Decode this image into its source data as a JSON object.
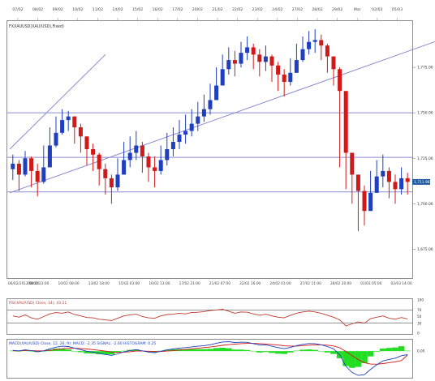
{
  "chart_data": [
    {
      "type": "candlestick",
      "title": "FXXAUUSD(XAU/USD),Fixed)",
      "top_dates": [
        "07/02",
        "08/02",
        "09/02",
        "10/02",
        "11/02",
        "14/02",
        "15/02",
        "16/02",
        "17/02",
        "20/02",
        "21/02",
        "22/02",
        "23/02",
        "24/02",
        "27/02",
        "28/02",
        "29/02",
        "Mar",
        "02/03",
        "05/03"
      ],
      "bottom_dates": [
        "06/02/2012 04:00",
        "08/02 23:00",
        "10/02 08:00",
        "13/02 18:00",
        "15/02 03:00",
        "16/02 13:00",
        "17/02 21:00",
        "21/02 07:00",
        "22/02 16:00",
        "24/02 01:00",
        "27/02 11:00",
        "28/02 20:00",
        "01/03 05:00",
        "02/03 14:00"
      ],
      "y_ticks": [
        "1,775.00",
        "1,750.00",
        "1,725.00",
        "1,700.00",
        "1,675.00"
      ],
      "ylim": [
        1660,
        1800
      ],
      "last_price": "1,711.98",
      "horizontal_lines": [
        1750.0,
        1725.5,
        1706.5
      ],
      "trend_lines": [
        {
          "from": [
            0,
            1730
          ],
          "to": [
            15,
            1782
          ]
        },
        {
          "from": [
            0,
            1706
          ],
          "to": [
            70,
            1791
          ]
        }
      ],
      "closes": [
        1722,
        1716,
        1725,
        1718,
        1712,
        1720,
        1732,
        1739,
        1746,
        1748,
        1742,
        1737,
        1730,
        1727,
        1719,
        1714,
        1709,
        1716,
        1724,
        1728,
        1732,
        1726,
        1720,
        1718,
        1724,
        1730,
        1734,
        1738,
        1740,
        1744,
        1748,
        1752,
        1757,
        1765,
        1774,
        1779,
        1777,
        1783,
        1786,
        1782,
        1778,
        1781,
        1776,
        1771,
        1767,
        1772,
        1779,
        1785,
        1789,
        1790,
        1787,
        1781,
        1774,
        1762,
        1728,
        1716,
        1707,
        1696,
        1706,
        1715,
        1718,
        1712,
        1708,
        1714,
        1712
      ],
      "highs": [
        1727,
        1724,
        1729,
        1726,
        1722,
        1732,
        1742,
        1748,
        1752,
        1751,
        1748,
        1744,
        1737,
        1733,
        1728,
        1722,
        1716,
        1725,
        1734,
        1737,
        1740,
        1734,
        1728,
        1726,
        1732,
        1739,
        1742,
        1746,
        1749,
        1752,
        1756,
        1760,
        1766,
        1775,
        1782,
        1786,
        1784,
        1789,
        1792,
        1788,
        1785,
        1787,
        1782,
        1778,
        1774,
        1780,
        1788,
        1792,
        1795,
        1796,
        1793,
        1788,
        1781,
        1775,
        1740,
        1728,
        1716,
        1710,
        1718,
        1724,
        1727,
        1720,
        1716,
        1720,
        1717
      ],
      "lows": [
        1713,
        1707,
        1715,
        1709,
        1704,
        1711,
        1724,
        1731,
        1738,
        1740,
        1733,
        1728,
        1721,
        1718,
        1710,
        1705,
        1700,
        1707,
        1716,
        1720,
        1724,
        1717,
        1712,
        1709,
        1716,
        1721,
        1726,
        1730,
        1733,
        1737,
        1740,
        1745,
        1749,
        1758,
        1767,
        1771,
        1770,
        1775,
        1779,
        1774,
        1770,
        1773,
        1767,
        1762,
        1759,
        1765,
        1772,
        1778,
        1782,
        1783,
        1779,
        1772,
        1765,
        1720,
        1708,
        1700,
        1685,
        1688,
        1698,
        1706,
        1709,
        1703,
        1700,
        1705,
        1705
      ],
      "rsi": {
        "label": "RSI(XAU/USD) Close, 14): 43.11",
        "ticks": [
          "100",
          "70",
          "50",
          "30",
          "0"
        ],
        "levels": [
          70,
          30
        ],
        "values": [
          52,
          48,
          55,
          46,
          42,
          50,
          58,
          62,
          60,
          64,
          56,
          52,
          47,
          46,
          42,
          40,
          38,
          45,
          52,
          55,
          57,
          50,
          46,
          45,
          52,
          56,
          57,
          60,
          58,
          62,
          63,
          65,
          68,
          70,
          72,
          66,
          60,
          64,
          63,
          58,
          54,
          57,
          52,
          48,
          46,
          54,
          60,
          64,
          66,
          64,
          60,
          54,
          48,
          40,
          22,
          28,
          34,
          30,
          44,
          48,
          52,
          45,
          42,
          47,
          43
        ]
      },
      "macd": {
        "label": "MACD(XAU/USD) Close, 12, 26, 9): MACD: -2.35 SIGNAL: -2.60 HISTOGRAM: 0.25",
        "zero_tick": "0.00",
        "macd_values": [
          0.5,
          0.2,
          0.8,
          0.3,
          -0.4,
          0.2,
          1.5,
          2.6,
          3.2,
          3.0,
          2.0,
          1.0,
          -0.1,
          -0.6,
          -1.5,
          -2.2,
          -2.8,
          -1.8,
          -0.5,
          0.4,
          1.0,
          0.2,
          -0.6,
          -1.0,
          -0.1,
          0.8,
          1.4,
          2.0,
          2.3,
          2.8,
          3.2,
          3.6,
          4.2,
          5.2,
          6.0,
          6.2,
          5.6,
          5.9,
          5.8,
          4.9,
          4.0,
          4.1,
          3.2,
          2.3,
          1.6,
          2.4,
          3.6,
          4.5,
          5.0,
          4.9,
          4.2,
          3.0,
          1.5,
          -2.5,
          -10.0,
          -14.0,
          -16.0,
          -15.5,
          -12.0,
          -9.0,
          -6.5,
          -5.5,
          -4.6,
          -3.0,
          -2.35
        ],
        "signal_values": [
          0.2,
          0.2,
          0.4,
          0.4,
          0.2,
          0.2,
          0.5,
          1.0,
          1.5,
          1.9,
          1.9,
          1.7,
          1.4,
          1.0,
          0.5,
          0.0,
          -0.6,
          -0.8,
          -0.7,
          -0.4,
          0.0,
          0.0,
          -0.1,
          -0.3,
          -0.3,
          0.0,
          0.3,
          0.7,
          1.1,
          1.5,
          1.9,
          2.3,
          2.7,
          3.2,
          3.8,
          4.3,
          4.6,
          4.9,
          5.1,
          5.1,
          4.9,
          4.7,
          4.4,
          4.0,
          3.5,
          3.3,
          3.3,
          3.6,
          3.9,
          4.1,
          4.1,
          3.9,
          3.4,
          2.2,
          -0.2,
          -3.0,
          -5.6,
          -7.6,
          -8.5,
          -8.6,
          -8.2,
          -7.6,
          -7.0,
          -6.2,
          -2.6
        ],
        "histogram_values": [
          0.3,
          0.0,
          0.4,
          -0.1,
          -0.6,
          0.0,
          1.0,
          1.6,
          1.7,
          1.1,
          0.1,
          -0.7,
          -1.5,
          -1.6,
          -2.0,
          -2.2,
          -2.2,
          -1.0,
          0.2,
          0.8,
          1.0,
          0.2,
          -0.5,
          -0.7,
          0.2,
          0.8,
          1.1,
          1.3,
          1.2,
          1.3,
          1.3,
          1.3,
          1.5,
          2.0,
          2.2,
          1.9,
          1.0,
          1.0,
          0.7,
          -0.2,
          -0.9,
          -0.6,
          -1.2,
          -1.7,
          -1.9,
          -0.9,
          0.3,
          0.9,
          1.1,
          0.8,
          0.1,
          -0.9,
          -1.9,
          -4.7,
          -9.8,
          -11.0,
          -10.4,
          -7.9,
          -3.5,
          -0.4,
          1.7,
          2.1,
          2.4,
          3.2,
          0.25
        ]
      }
    }
  ],
  "colors": {
    "up": "#1f3fbf",
    "down": "#d11919",
    "panel_border": "#8c8c8c",
    "level_line": "#8a8ad0",
    "rsi_line": "#c0392b",
    "macd_line": "#1f3fbf",
    "signal_line": "#d11919",
    "histogram": "#22dd22",
    "price_tag_bg": "#1f5aa0"
  }
}
